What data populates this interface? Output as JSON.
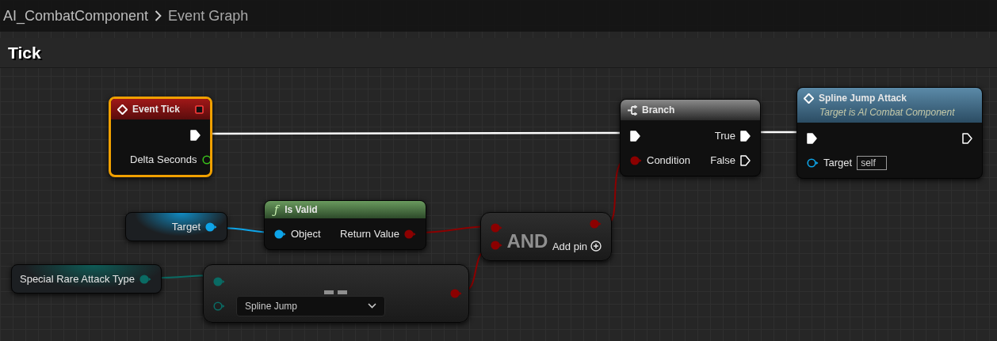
{
  "breadcrumb": {
    "items": [
      "AI_CombatComponent",
      "Event Graph"
    ]
  },
  "graph": {
    "title": "Tick"
  },
  "nodes": [
    {
      "kind": "event",
      "title": "Event Tick",
      "selected": true,
      "rows": [
        {
          "right": {
            "kind": "exec",
            "connected": true
          }
        },
        {
          "right": {
            "label": "Delta Seconds",
            "kind": "float",
            "connected": false
          }
        }
      ]
    },
    {
      "kind": "branch",
      "title": "Branch",
      "selected": false,
      "rows": [
        {
          "left": {
            "kind": "exec",
            "connected": true
          },
          "right": {
            "label": "True",
            "kind": "exec",
            "connected": true
          }
        },
        {
          "left": {
            "label": "Condition",
            "kind": "bool",
            "connected": true
          },
          "right": {
            "label": "False",
            "kind": "exec",
            "connected": false
          }
        }
      ]
    },
    {
      "kind": "function",
      "title": "Spline Jump Attack",
      "subtitle": "Target is AI Combat Component",
      "selected": false,
      "rows": [
        {
          "left": {
            "kind": "exec",
            "connected": true
          },
          "right": {
            "kind": "exec",
            "connected": false
          }
        },
        {
          "left": {
            "label": "Target",
            "kind": "object",
            "connected": false,
            "value": "self"
          }
        }
      ]
    },
    {
      "kind": "variable",
      "selected": false,
      "rows": [
        {
          "right": {
            "label": "Target",
            "kind": "object",
            "connected": true
          }
        }
      ]
    },
    {
      "kind": "pure",
      "title": "Is Valid",
      "icon_glyph": "ƒ",
      "selected": false,
      "rows": [
        {
          "left": {
            "label": "Object",
            "kind": "object",
            "connected": true
          },
          "right": {
            "label": "Return Value",
            "kind": "bool",
            "connected": true
          }
        }
      ]
    },
    {
      "kind": "operator",
      "title": "AND",
      "add_pin": "Add pin",
      "selected": false,
      "rows": [
        {
          "left": {
            "kind": "bool",
            "connected": true
          },
          "right": {
            "kind": "bool",
            "connected": true
          }
        },
        {
          "left": {
            "kind": "bool",
            "connected": true
          }
        }
      ]
    },
    {
      "kind": "variable",
      "selected": false,
      "rows": [
        {
          "right": {
            "label": "Special Rare Attack Type",
            "kind": "enum",
            "connected": true
          }
        }
      ]
    },
    {
      "kind": "compare",
      "selected": false,
      "rows": [
        {
          "left": {
            "kind": "enum",
            "connected": true
          },
          "right": {
            "kind": "bool",
            "connected": true
          }
        },
        {
          "left": {
            "kind": "enum",
            "connected": false,
            "value": "Spline Jump"
          }
        }
      ]
    }
  ]
}
